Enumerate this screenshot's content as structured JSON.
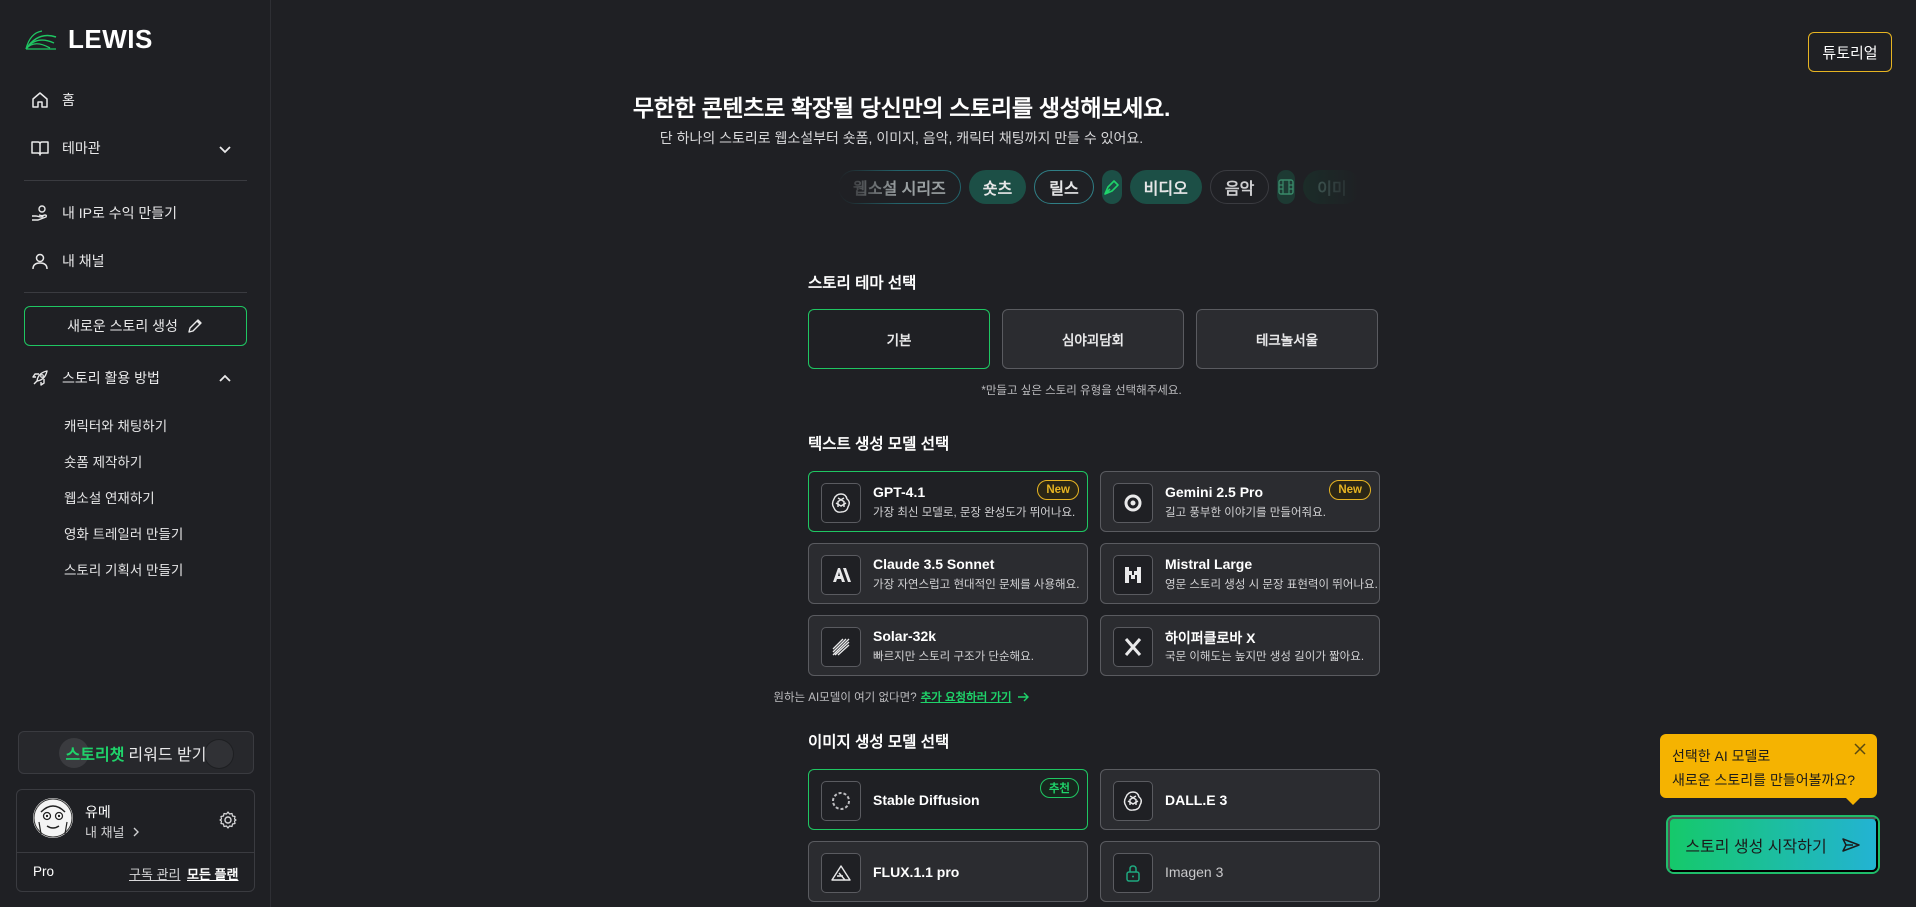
{
  "brand": {
    "name": "LEWIS"
  },
  "sidebar": {
    "home": "홈",
    "theme": "테마관",
    "ip_income": "내 IP로 수익 만들기",
    "my_channel": "내 채널",
    "new_story": "새로운 스토리 생성",
    "how_to_use": "스토리 활용 방법",
    "sub_items": [
      "캐릭터와 채팅하기",
      "숏폼 제작하기",
      "웹소설 연재하기",
      "영화 트레일러 만들기",
      "스토리 기획서 만들기"
    ],
    "reward": {
      "highlight": "스토리챗",
      "text": "리워드 받기"
    },
    "profile": {
      "name": "유메",
      "channel": "내 채널",
      "plan": "Pro",
      "manage": "구독 관리",
      "all_plans": "모든 플랜"
    }
  },
  "header": {
    "tutorial": "튜토리얼"
  },
  "hero": {
    "title": "무한한 콘텐츠로 확장될 당신만의 스토리를 생성해보세요.",
    "subtitle": "단 하나의 스토리로 웹소설부터 숏폼, 이미지, 음악, 캐릭터 채팅까지 만들 수 있어요.",
    "chips": [
      "웹소설 시리즈",
      "숏츠",
      "릴스",
      "비디오",
      "음악",
      "이미"
    ]
  },
  "theme_section": {
    "title": "스토리 테마 선택",
    "options": [
      "기본",
      "심야괴담회",
      "테크놀서울"
    ],
    "hint": "*만들고 싶은 스토리 유형을 선택해주세요."
  },
  "text_models": {
    "title": "텍스트 생성 모델 선택",
    "items": [
      {
        "name": "GPT-4.1",
        "desc": "가장 최신 모델로, 문장 완성도가 뛰어나요.",
        "badge": "New",
        "icon": "openai-icon"
      },
      {
        "name": "Gemini 2.5 Pro",
        "desc": "길고 풍부한 이야기를 만들어줘요.",
        "badge": "New",
        "icon": "gemini-icon"
      },
      {
        "name": "Claude 3.5 Sonnet",
        "desc": "가장 자연스럽고 현대적인 문체를 사용해요.",
        "icon": "anthropic-icon"
      },
      {
        "name": "Mistral Large",
        "desc": "영문 스토리 생성 시 문장 표현력이 뛰어나요.",
        "icon": "mistral-icon"
      },
      {
        "name": "Solar-32k",
        "desc": "빠르지만 스토리 구조가 단순해요.",
        "icon": "solar-icon"
      },
      {
        "name": "하이퍼클로바 X",
        "desc": "국문 이해도는 높지만 생성 길이가 짧아요.",
        "icon": "clova-icon"
      }
    ],
    "request_text": "원하는 AI모델이 여기 없다면?",
    "request_link": "추가 요청하러 가기"
  },
  "image_models": {
    "title": "이미지 생성 모델 선택",
    "items": [
      {
        "name": "Stable Diffusion",
        "badge": "추천",
        "icon": "stability-icon"
      },
      {
        "name": "DALL.E 3",
        "icon": "openai-icon"
      },
      {
        "name": "FLUX.1.1 pro",
        "icon": "flux-icon"
      },
      {
        "name": "Imagen 3",
        "icon": "lock-icon"
      }
    ]
  },
  "tooltip": {
    "line1": "선택한 AI 모델로",
    "line2": "새로운 스토리를 만들어볼까요?"
  },
  "cta": {
    "label": "스토리 생성 시작하기"
  },
  "colors": {
    "accent_green": "#1fc662",
    "badge_yellow": "#e6b422",
    "tooltip_bg": "#f5b301",
    "background": "#1f2024"
  }
}
